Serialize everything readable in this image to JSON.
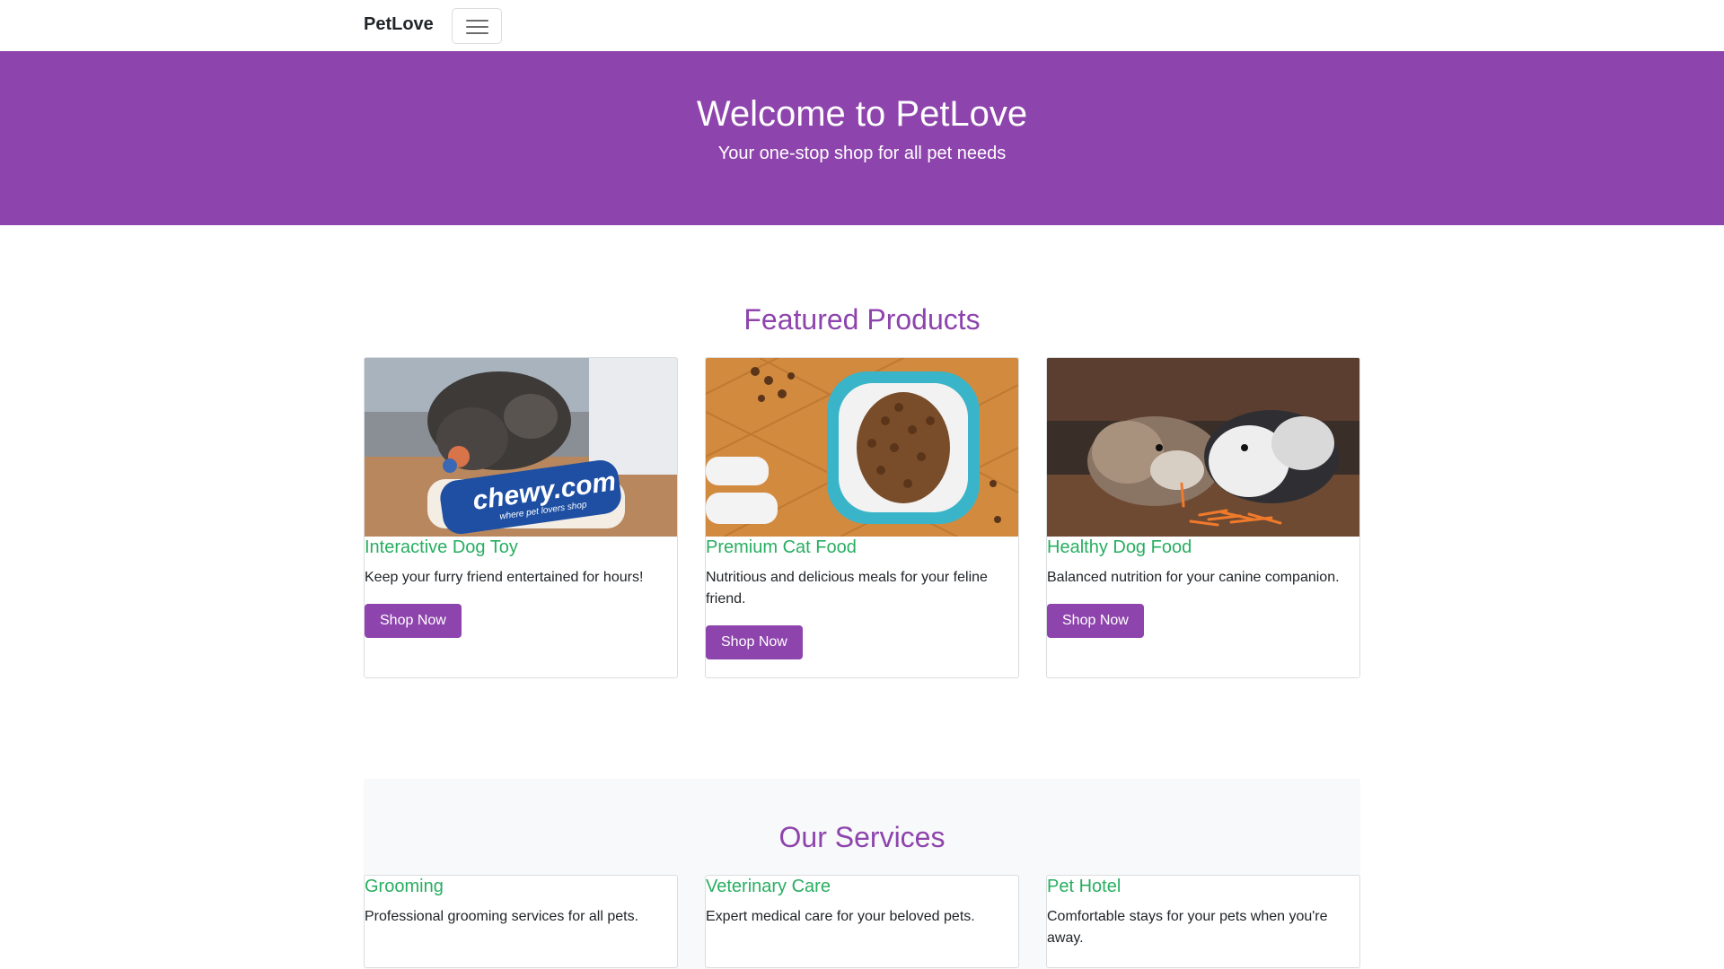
{
  "navbar": {
    "brand": "PetLove",
    "menu_icon": "hamburger-menu-icon"
  },
  "hero": {
    "title": "Welcome to PetLove",
    "subtitle": "Your one-stop shop for all pet needs"
  },
  "featured": {
    "heading": "Featured Products",
    "products": [
      {
        "title": "Interactive Dog Toy",
        "description": "Keep your furry friend entertained for hours!",
        "button": "Shop Now",
        "image": "dog-with-chewy-toy-image",
        "image_text": "chewy.com",
        "image_subtext": "where pet lovers shop"
      },
      {
        "title": "Premium Cat Food",
        "description": "Nutritious and delicious meals for your feline friend.",
        "button": "Shop Now",
        "image": "cat-food-bowl-image"
      },
      {
        "title": "Healthy Dog Food",
        "description": "Balanced nutrition for your canine companion.",
        "button": "Shop Now",
        "image": "guinea-pigs-eating-image"
      }
    ]
  },
  "services": {
    "heading": "Our Services",
    "items": [
      {
        "title": "Grooming",
        "description": "Professional grooming services for all pets."
      },
      {
        "title": "Veterinary Care",
        "description": "Expert medical care for your beloved pets."
      },
      {
        "title": "Pet Hotel",
        "description": "Comfortable stays for your pets when you're away."
      }
    ]
  },
  "colors": {
    "brand_purple": "#8e44ad",
    "title_green": "#27ae60",
    "services_bg": "#f8f9fa"
  }
}
